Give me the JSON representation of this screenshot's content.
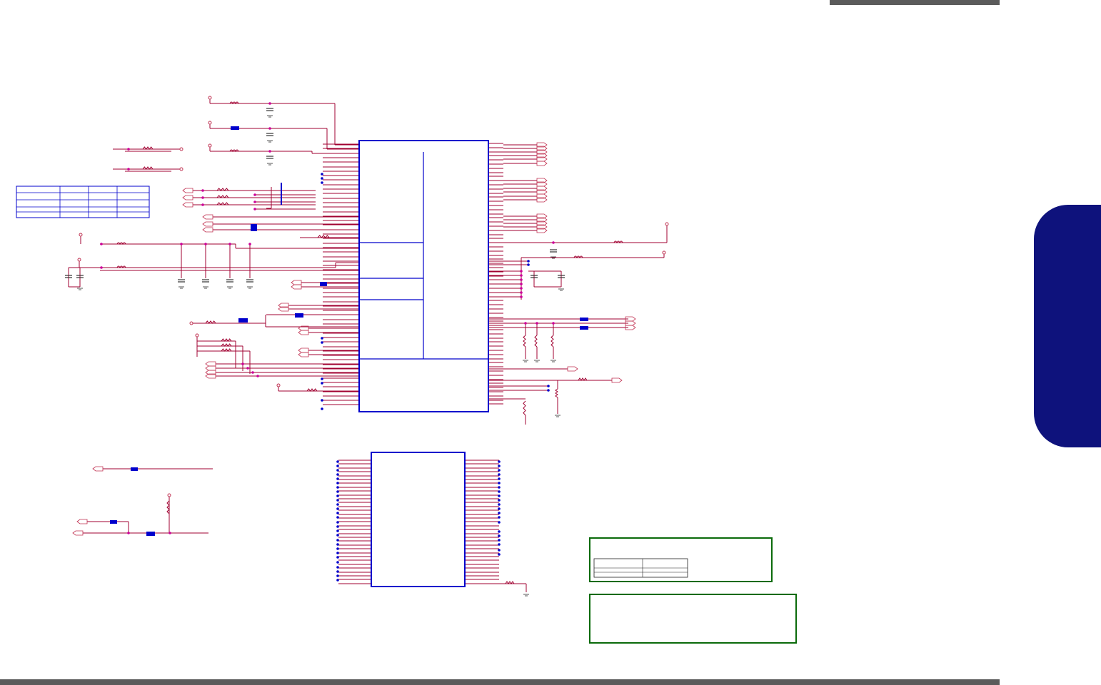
{
  "page": {
    "side_tab_label": "",
    "colors": {
      "wire": "#a00030",
      "component": "#0000cc",
      "junction": "#cc0099",
      "net_pin": "#0000cc",
      "title_box": "#0a6a0a",
      "bars": "#5b5b5b",
      "side_tab": "#0e127c"
    },
    "icons": [
      "resistor-icon",
      "capacitor-icon",
      "inductor-icon",
      "ground-icon",
      "power-pin-icon",
      "off-page-connector-icon"
    ]
  }
}
